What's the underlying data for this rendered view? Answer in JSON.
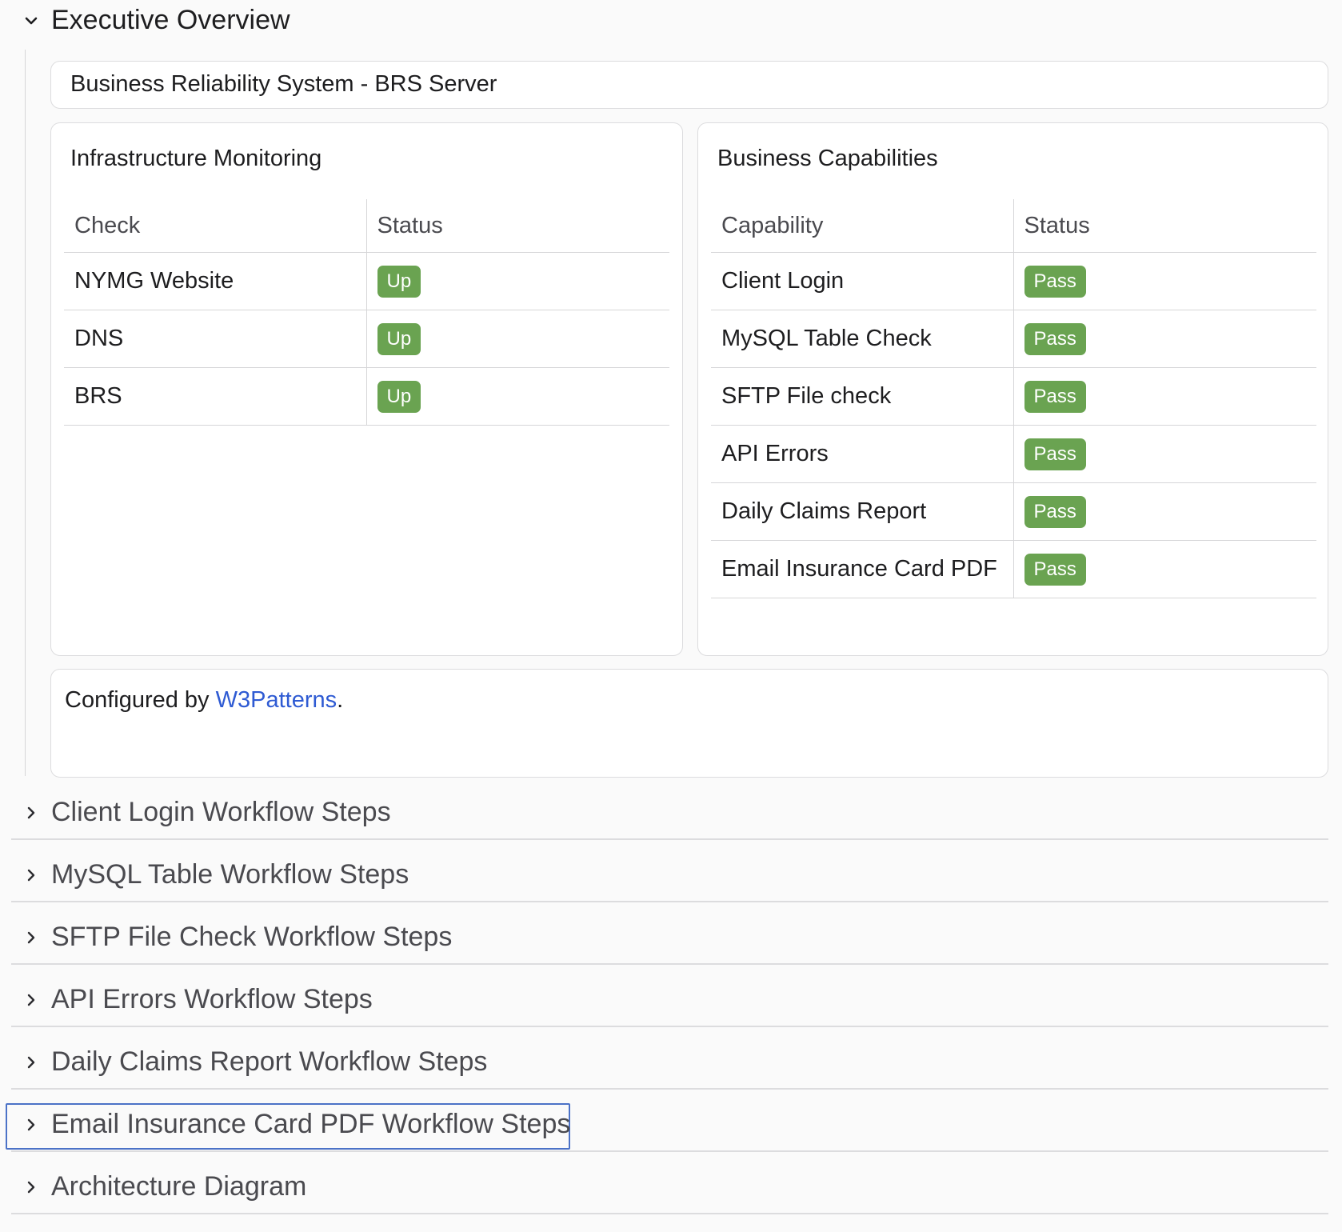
{
  "executive_overview": {
    "title": "Executive Overview",
    "system_title": "Business Reliability System - BRS Server",
    "infrastructure": {
      "title": "Infrastructure Monitoring",
      "headers": [
        "Check",
        "Status"
      ],
      "rows": [
        {
          "check": "NYMG Website",
          "status": "Up"
        },
        {
          "check": "DNS",
          "status": "Up"
        },
        {
          "check": "BRS",
          "status": "Up"
        }
      ]
    },
    "capabilities": {
      "title": "Business Capabilities",
      "headers": [
        "Capability",
        "Status"
      ],
      "rows": [
        {
          "capability": "Client Login",
          "status": "Pass"
        },
        {
          "capability": "MySQL Table Check",
          "status": "Pass"
        },
        {
          "capability": "SFTP File check",
          "status": "Pass"
        },
        {
          "capability": "API Errors",
          "status": "Pass"
        },
        {
          "capability": "Daily Claims Report",
          "status": "Pass"
        },
        {
          "capability": "Email Insurance Card PDF",
          "status": "Pass"
        }
      ]
    },
    "configured_prefix": "Configured by ",
    "configured_link": "W3Patterns",
    "configured_suffix": "."
  },
  "sections": [
    "Client Login Workflow Steps",
    "MySQL Table Workflow Steps",
    "SFTP File Check Workflow Steps",
    "API Errors Workflow Steps",
    "Daily Claims Report Workflow Steps",
    "Email Insurance Card PDF Workflow Steps",
    "Architecture Diagram"
  ],
  "colors": {
    "badge_green": "#6aa351",
    "link_blue": "#2f5bd3",
    "focus_blue": "#4b72c7"
  }
}
